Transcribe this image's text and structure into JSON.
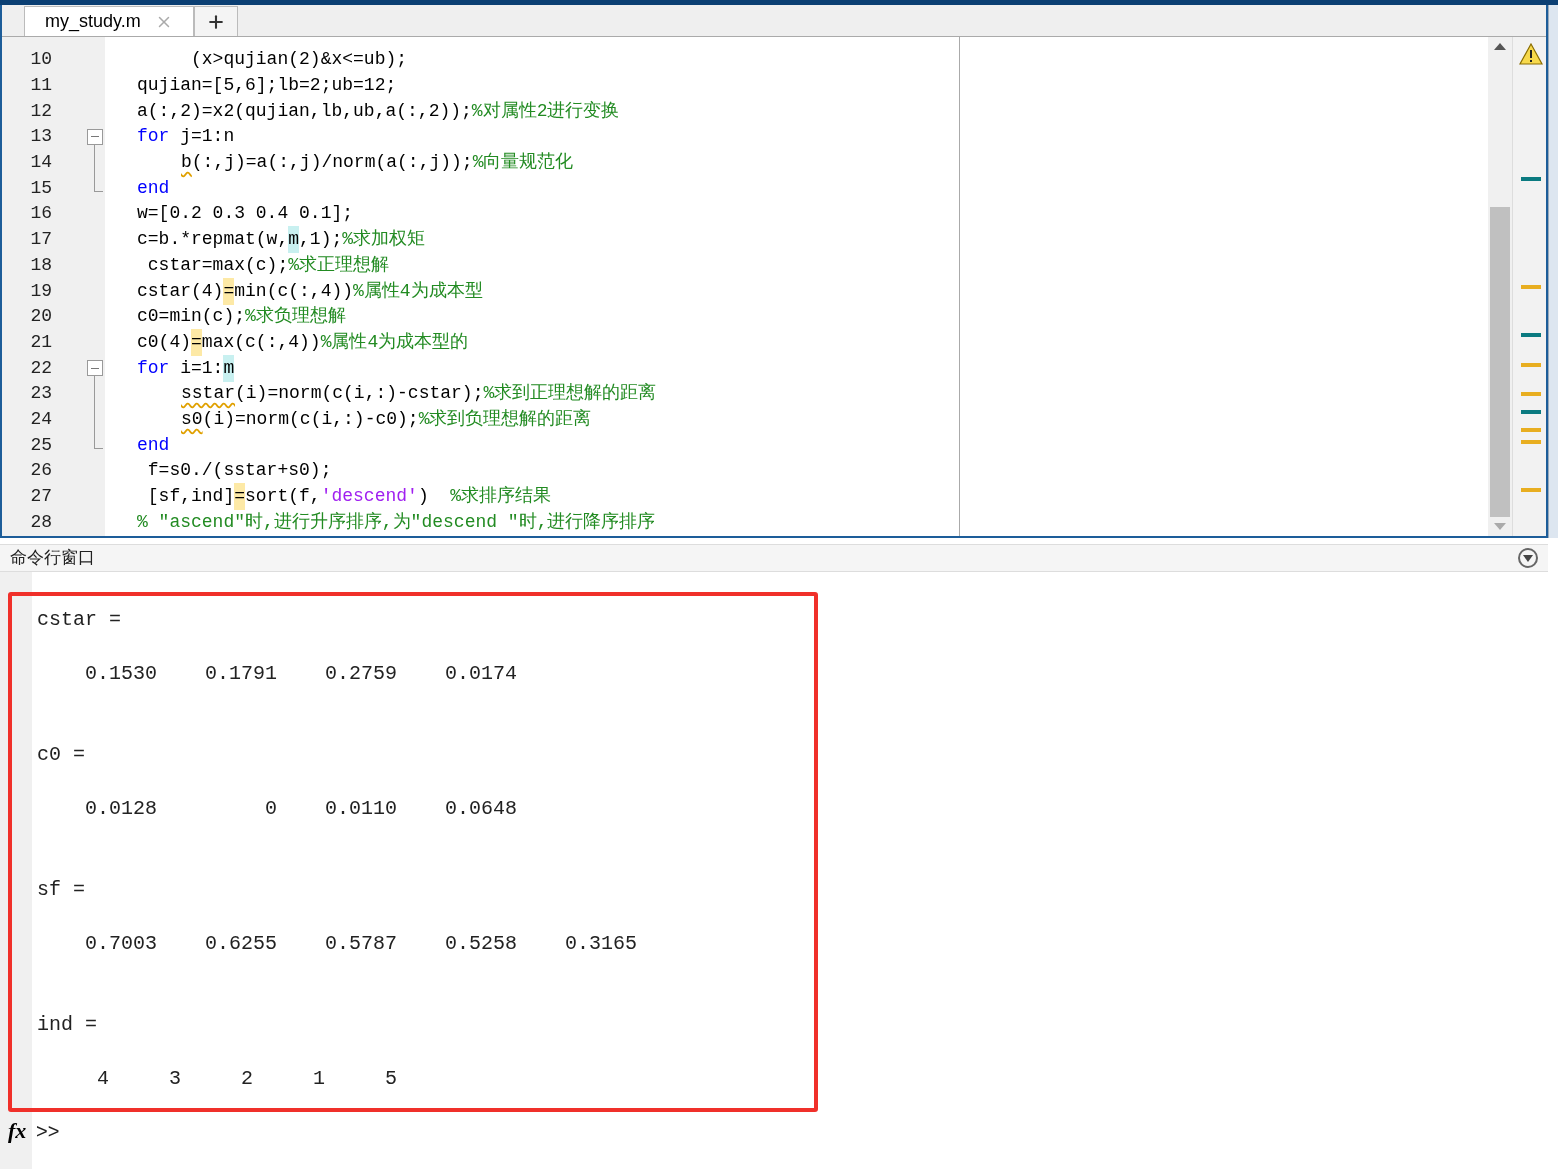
{
  "editor": {
    "tabs": [
      {
        "label": "my_study.m",
        "selected": true
      }
    ],
    "lines": [
      {
        "number": "10",
        "kind": "plain",
        "segments": [
          {
            "kind": "code",
            "text": "     (x>qujian(2)&x<=ub);"
          }
        ]
      },
      {
        "number": "11",
        "kind": "plain",
        "segments": [
          {
            "kind": "code",
            "text": "qujian=[5,6];lb=2;ub=12;"
          }
        ]
      },
      {
        "number": "12",
        "kind": "plain",
        "segments": [
          {
            "kind": "code",
            "text": "a(:,2)=x2(qujian,lb,ub,a(:,2));"
          },
          {
            "kind": "comment",
            "text": "%对属性2进行变换"
          }
        ]
      },
      {
        "number": "13",
        "kind": "fold_start",
        "segments": [
          {
            "kind": "keyword",
            "text": "for"
          },
          {
            "kind": "code",
            "text": " j=1:n"
          }
        ]
      },
      {
        "number": "14",
        "kind": "fold_body",
        "segments": [
          {
            "kind": "flagged",
            "text": "b"
          },
          {
            "kind": "code",
            "text": "(:,j)=a(:,j)/norm(a(:,j));"
          },
          {
            "kind": "comment",
            "text": "%向量规范化"
          }
        ]
      },
      {
        "number": "15",
        "kind": "fold_end",
        "segments": [
          {
            "kind": "keyword",
            "text": "end"
          }
        ]
      },
      {
        "number": "16",
        "kind": "plain",
        "segments": [
          {
            "kind": "code",
            "text": "w=[0.2 0.3 0.4 0.1];"
          }
        ]
      },
      {
        "number": "17",
        "kind": "plain",
        "segments": [
          {
            "kind": "code",
            "text": "c=b.*repmat(w,"
          },
          {
            "kind": "match",
            "text": "m"
          },
          {
            "kind": "code",
            "text": ",1);"
          },
          {
            "kind": "comment",
            "text": "%求加权矩"
          }
        ]
      },
      {
        "number": "18",
        "kind": "plain",
        "segments": [
          {
            "kind": "code",
            "text": " cstar=max(c);"
          },
          {
            "kind": "comment",
            "text": "%求正理想解"
          }
        ]
      },
      {
        "number": "19",
        "kind": "plain",
        "segments": [
          {
            "kind": "code",
            "text": "cstar(4)"
          },
          {
            "kind": "warning",
            "text": "="
          },
          {
            "kind": "code",
            "text": "min(c(:,4))"
          },
          {
            "kind": "comment",
            "text": "%属性4为成本型"
          }
        ]
      },
      {
        "number": "20",
        "kind": "plain",
        "segments": [
          {
            "kind": "code",
            "text": "c0=min(c);"
          },
          {
            "kind": "comment",
            "text": "%求负理想解"
          }
        ]
      },
      {
        "number": "21",
        "kind": "plain",
        "segments": [
          {
            "kind": "code",
            "text": "c0(4)"
          },
          {
            "kind": "warning",
            "text": "="
          },
          {
            "kind": "code",
            "text": "max(c(:,4))"
          },
          {
            "kind": "comment",
            "text": "%属性4为成本型的"
          }
        ]
      },
      {
        "number": "22",
        "kind": "fold_start",
        "segments": [
          {
            "kind": "keyword",
            "text": "for"
          },
          {
            "kind": "code",
            "text": " i=1:"
          },
          {
            "kind": "match",
            "text": "m"
          }
        ]
      },
      {
        "number": "23",
        "kind": "fold_body",
        "segments": [
          {
            "kind": "flagged",
            "text": "sstar"
          },
          {
            "kind": "code",
            "text": "(i)=norm(c(i,:)-cstar);"
          },
          {
            "kind": "comment",
            "text": "%求到正理想解的距离"
          }
        ]
      },
      {
        "number": "24",
        "kind": "fold_body",
        "segments": [
          {
            "kind": "flagged",
            "text": "s0"
          },
          {
            "kind": "code",
            "text": "(i)=norm(c(i,:)-c0);"
          },
          {
            "kind": "comment",
            "text": "%求到负理想解的距离"
          }
        ]
      },
      {
        "number": "25",
        "kind": "fold_end",
        "segments": [
          {
            "kind": "keyword",
            "text": "end"
          }
        ]
      },
      {
        "number": "26",
        "kind": "plain",
        "segments": [
          {
            "kind": "code",
            "text": " f=s0./(sstar+s0);"
          }
        ]
      },
      {
        "number": "27",
        "kind": "plain",
        "segments": [
          {
            "kind": "code",
            "text": " [sf,ind]"
          },
          {
            "kind": "warning",
            "text": "="
          },
          {
            "kind": "code",
            "text": "sort(f,"
          },
          {
            "kind": "string",
            "text": "'descend'"
          },
          {
            "kind": "code",
            "text": ")  "
          },
          {
            "kind": "comment",
            "text": "%求排序结果"
          }
        ]
      },
      {
        "number": "28",
        "kind": "plain",
        "segments": [
          {
            "kind": "comment",
            "text": "% \"ascend\"时,进行升序排序,为\"descend \"时,进行降序排序"
          }
        ]
      }
    ]
  },
  "command_window": {
    "title": "命令行窗口",
    "blocks": [
      {
        "kind": "decimal",
        "label": "cstar =",
        "values": [
          "0.1530",
          "0.1791",
          "0.2759",
          "0.0174"
        ]
      },
      {
        "kind": "decimal",
        "label": "c0 =",
        "values": [
          "0.0128",
          "0",
          "0.0110",
          "0.0648"
        ]
      },
      {
        "kind": "decimal",
        "label": "sf =",
        "values": [
          "0.7003",
          "0.6255",
          "0.5787",
          "0.5258",
          "0.3165"
        ]
      },
      {
        "kind": "integer",
        "label": "ind =",
        "values": [
          "4",
          "3",
          "2",
          "1",
          "5"
        ]
      }
    ],
    "function_icon": "fx",
    "prompt": ">>"
  }
}
